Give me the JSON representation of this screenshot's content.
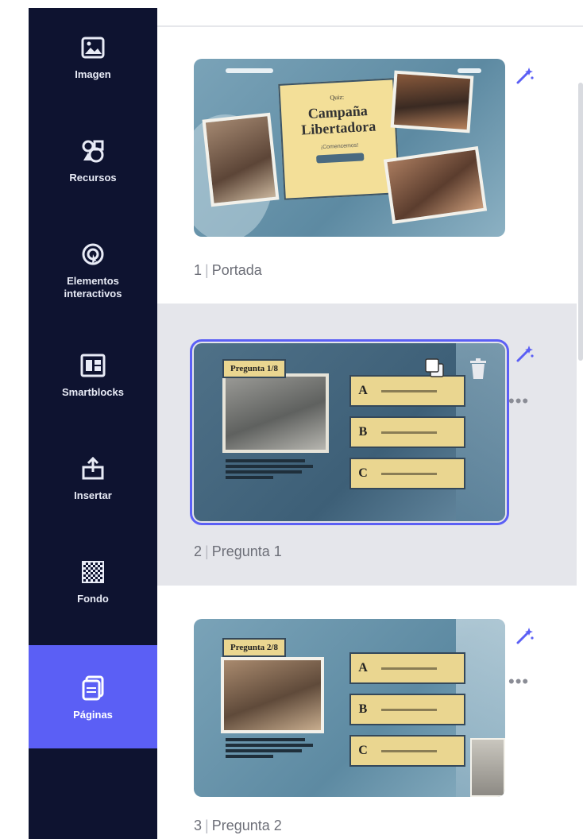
{
  "sidebar": {
    "items": [
      {
        "label": "Imagen",
        "icon": "image-icon"
      },
      {
        "label": "Recursos",
        "icon": "shapes-icon"
      },
      {
        "label": "Elementos interactivos",
        "icon": "interactive-icon"
      },
      {
        "label": "Smartblocks",
        "icon": "smartblocks-icon"
      },
      {
        "label": "Insertar",
        "icon": "insert-icon"
      },
      {
        "label": "Fondo",
        "icon": "background-icon"
      },
      {
        "label": "Páginas",
        "icon": "pages-icon",
        "active": true
      }
    ]
  },
  "pages": [
    {
      "number": "1",
      "name": "Portada",
      "slide": {
        "kicker": "Quiz:",
        "title_line1": "Campaña",
        "title_line2": "Libertadora",
        "subtitle": "¡Comencemos!"
      }
    },
    {
      "number": "2",
      "name": "Pregunta 1",
      "selected": true,
      "slide": {
        "tag": "Pregunta 1/8",
        "options": [
          "A",
          "B",
          "C"
        ]
      }
    },
    {
      "number": "3",
      "name": "Pregunta 2",
      "slide": {
        "tag": "Pregunta 2/8",
        "options": [
          "A",
          "B",
          "C"
        ]
      }
    }
  ],
  "colors": {
    "sidebar_bg": "#0e1330",
    "accent": "#5b5ff5",
    "selected_row": "#e5e6eb",
    "slide_paper": "#f3df98"
  }
}
